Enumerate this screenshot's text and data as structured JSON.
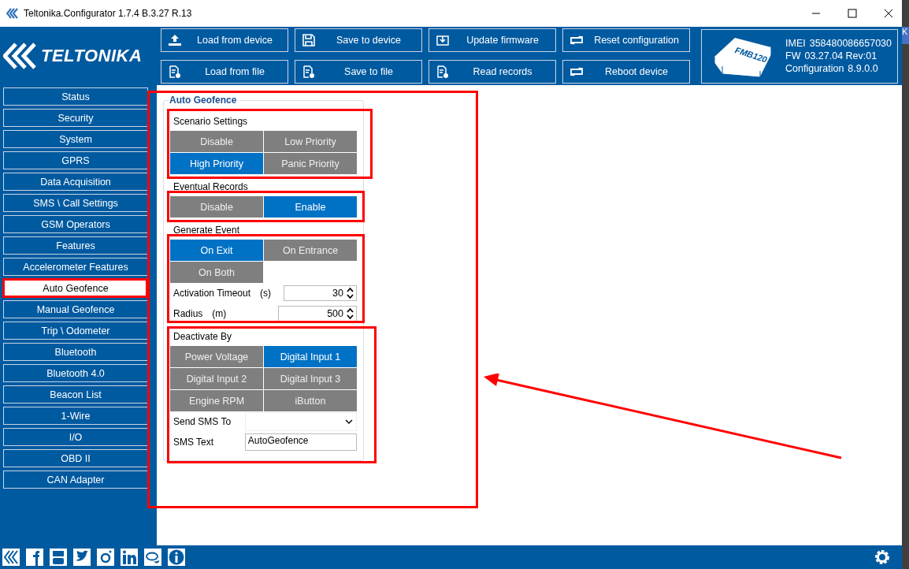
{
  "window": {
    "title": "Teltonika.Configurator 1.7.4 B.3.27 R.13"
  },
  "background_window": {
    "text": "K"
  },
  "logo": {
    "text": "TELTONIKA"
  },
  "toolbar": [
    {
      "label": "Load from device"
    },
    {
      "label": "Save to device"
    },
    {
      "label": "Update firmware"
    },
    {
      "label": "Reset configuration"
    },
    {
      "label": "Load from file"
    },
    {
      "label": "Save to file"
    },
    {
      "label": "Read records"
    },
    {
      "label": "Reboot device"
    }
  ],
  "device": {
    "model": "FMB120",
    "imei_label": "IMEI",
    "imei": "358480086657030",
    "fw_label": "FW",
    "fw": "03.27.04 Rev:01",
    "config_label": "Configuration",
    "config": "8.9.0.0"
  },
  "sidebar": {
    "items": [
      {
        "label": "Status",
        "selected": false
      },
      {
        "label": "Security",
        "selected": false
      },
      {
        "label": "System",
        "selected": false
      },
      {
        "label": "GPRS",
        "selected": false
      },
      {
        "label": "Data Acquisition",
        "selected": false
      },
      {
        "label": "SMS \\ Call Settings",
        "selected": false
      },
      {
        "label": "GSM Operators",
        "selected": false
      },
      {
        "label": "Features",
        "selected": false
      },
      {
        "label": "Accelerometer Features",
        "selected": false
      },
      {
        "label": "Auto Geofence",
        "selected": true
      },
      {
        "label": "Manual Geofence",
        "selected": false
      },
      {
        "label": "Trip \\ Odometer",
        "selected": false
      },
      {
        "label": "Bluetooth",
        "selected": false
      },
      {
        "label": "Bluetooth 4.0",
        "selected": false
      },
      {
        "label": "Beacon List",
        "selected": false
      },
      {
        "label": "1-Wire",
        "selected": false
      },
      {
        "label": "I/O",
        "selected": false
      },
      {
        "label": "OBD II",
        "selected": false
      },
      {
        "label": "CAN Adapter",
        "selected": false
      }
    ]
  },
  "panel": {
    "title": "Auto Geofence",
    "sections": [
      {
        "label": "Scenario Settings",
        "options": [
          {
            "label": "Disable",
            "selected": false
          },
          {
            "label": "Low Priority",
            "selected": false
          },
          {
            "label": "High Priority",
            "selected": true
          },
          {
            "label": "Panic Priority",
            "selected": false
          }
        ]
      },
      {
        "label": "Eventual Records",
        "options": [
          {
            "label": "Disable",
            "selected": false
          },
          {
            "label": "Enable",
            "selected": true
          }
        ]
      },
      {
        "label": "Generate Event",
        "options": [
          {
            "label": "On Exit",
            "selected": true
          },
          {
            "label": "On Entrance",
            "selected": false
          },
          {
            "label": "On Both",
            "selected": false
          }
        ],
        "fields": [
          {
            "kind": "spin",
            "label": "Activation Timeout",
            "unit": "(s)",
            "value": "30"
          },
          {
            "kind": "spin",
            "label": "Radius",
            "unit": "(m)",
            "value": "500"
          }
        ]
      },
      {
        "label": "Deactivate By",
        "options": [
          {
            "label": "Power Voltage",
            "selected": false
          },
          {
            "label": "Digital Input 1",
            "selected": true
          },
          {
            "label": "Digital Input 2",
            "selected": false
          },
          {
            "label": "Digital Input 3",
            "selected": false
          },
          {
            "label": "Engine RPM",
            "selected": false
          },
          {
            "label": "iButton",
            "selected": false
          }
        ],
        "fields": [
          {
            "kind": "select",
            "label": "Send SMS To"
          },
          {
            "kind": "text",
            "label": "SMS Text",
            "value": "AutoGeofence"
          }
        ]
      }
    ]
  }
}
